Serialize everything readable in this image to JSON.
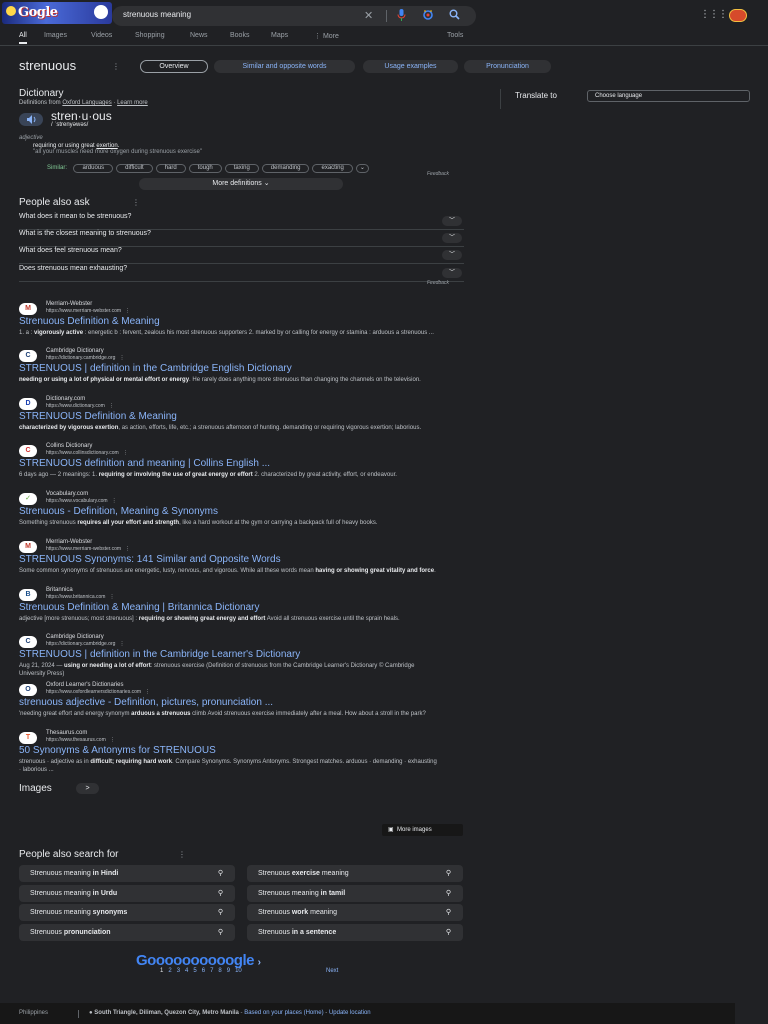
{
  "header": {
    "logo_text": "Gogle",
    "query": "strenuous meaning",
    "clear_icon": "close-icon",
    "mic_icon": "microphone-icon",
    "lens_icon": "lens-icon",
    "search_icon": "search-icon",
    "apps_icon": "apps-grid-icon"
  },
  "tabs": [
    {
      "label": "All"
    },
    {
      "label": "Images"
    },
    {
      "label": "Videos"
    },
    {
      "label": "Shopping"
    },
    {
      "label": "News"
    },
    {
      "label": "Books"
    },
    {
      "label": "Maps"
    },
    {
      "label": "⋮ More"
    }
  ],
  "tools_label": "Tools",
  "term_bar": {
    "term": "strenuous",
    "chips": [
      "Overview",
      "Similar and opposite words",
      "Usage examples",
      "Pronunciation"
    ]
  },
  "dictionary": {
    "title": "Dictionary",
    "source_prefix": "Definitions from",
    "source": "Oxford Languages",
    "learn_more": "Learn more",
    "headword": "stren·u·ous",
    "phonetic": "/ ˈstrenyəwəs/",
    "pos": "adjective",
    "definition_start": "requiring or using great ",
    "definition_link": "exertion",
    "definition_end": ".",
    "example": "\"all your muscles need more oxygen during strenuous exercise\"",
    "similar_label": "Similar:",
    "similar": [
      "arduous",
      "difficult",
      "hard",
      "tough",
      "taxing",
      "demanding",
      "exacting"
    ],
    "feedback": "Feedback",
    "more_definitions": "More definitions",
    "translate_label": "Translate to",
    "choose_language": "Choose language"
  },
  "paa": {
    "title": "People also ask",
    "questions": [
      "What does it mean to be strenuous?",
      "What is the closest meaning to strenuous?",
      "What does feel strenuous mean?",
      "Does strenuous mean exhausting?"
    ],
    "feedback": "Feedback"
  },
  "results": [
    {
      "site": "Merriam-Webster",
      "url": "https://www.merriam-webster.com",
      "title": "Strenuous Definition & Meaning",
      "fav": "M",
      "fav_color": "#c0392b",
      "snippet_pre": "1. a : ",
      "snippet_bold": "vigorously active",
      "snippet_post": " : energetic b : fervent, zealous his most strenuous supporters 2. marked by or calling for energy or stamina : arduous a strenuous ..."
    },
    {
      "site": "Cambridge Dictionary",
      "url": "https://dictionary.cambridge.org",
      "title": "STRENUOUS | definition in the Cambridge English Dictionary",
      "fav": "C",
      "fav_color": "#1d3f75",
      "snippet_pre": "",
      "snippet_bold": "needing or using a lot of physical or mental effort or energy",
      "snippet_post": ". He rarely does anything more strenuous than changing the channels on the television."
    },
    {
      "site": "Dictionary.com",
      "url": "https://www.dictionary.com",
      "title": "STRENUOUS Definition & Meaning",
      "fav": "D",
      "fav_color": "#1a3fb0",
      "snippet_pre": "",
      "snippet_bold": "characterized by vigorous exertion",
      "snippet_post": ", as action, efforts, life, etc.; a strenuous afternoon of hunting. demanding or requiring vigorous exertion; laborious."
    },
    {
      "site": "Collins Dictionary",
      "url": "https://www.collinsdictionary.com",
      "title": "STRENUOUS definition and meaning | Collins English ...",
      "fav": "C",
      "fav_color": "#d32f2f",
      "snippet_pre": "6 days ago — 2 meanings: 1. ",
      "snippet_bold": "requiring or involving the use of great energy or effort",
      "snippet_post": " 2. characterized by great activity, effort, or endeavour."
    },
    {
      "site": "Vocabulary.com",
      "url": "https://www.vocabulary.com",
      "title": "Strenuous - Definition, Meaning & Synonyms",
      "fav": "✓",
      "fav_color": "#5fa83a",
      "snippet_pre": "Something strenuous ",
      "snippet_bold": "requires all your effort and strength",
      "snippet_post": ", like a hard workout at the gym or carrying a backpack full of heavy books."
    },
    {
      "site": "Merriam-Webster",
      "url": "https://www.merriam-webster.com",
      "title": "STRENUOUS Synonyms: 141 Similar and Opposite Words",
      "fav": "M",
      "fav_color": "#c0392b",
      "snippet_pre": "Some common synonyms of strenuous are energetic, lusty, nervous, and vigorous. While all these words mean ",
      "snippet_bold": "having or showing great vitality and force",
      "snippet_post": "."
    },
    {
      "site": "Britannica",
      "url": "https://www.britannica.com",
      "title": "Strenuous Definition & Meaning | Britannica Dictionary",
      "fav": "B",
      "fav_color": "#1a4e8a",
      "snippet_pre": "adjective [more strenuous; most strenuous] : ",
      "snippet_bold": "requiring or showing great energy and effort",
      "snippet_post": " Avoid all strenuous exercise until the sprain heals."
    },
    {
      "site": "Cambridge Dictionary",
      "url": "https://dictionary.cambridge.org",
      "title": "STRENUOUS | definition in the Cambridge Learner's Dictionary",
      "fav": "C",
      "fav_color": "#1d3f75",
      "snippet_pre": "Aug 21, 2024 — ",
      "snippet_bold": "using or needing a lot of effort",
      "snippet_post": ": strenuous exercise (Definition of strenuous from the Cambridge Learner's Dictionary © Cambridge University Press)"
    },
    {
      "site": "Oxford Learner's Dictionaries",
      "url": "https://www.oxfordlearnersdictionaries.com",
      "title": "strenuous adjective - Definition, pictures, pronunciation ...",
      "fav": "O",
      "fav_color": "#1d3f75",
      "snippet_pre": "'needing great effort and energy synonym ",
      "snippet_bold": "arduous a strenuous",
      "snippet_post": " climb Avoid strenuous exercise immediately after a meal. How about a stroll in the park?"
    },
    {
      "site": "Thesaurus.com",
      "url": "https://www.thesaurus.com",
      "title": "50 Synonyms & Antonyms for STRENUOUS",
      "fav": "T",
      "fav_color": "#e8582b",
      "snippet_pre": "strenuous · adjective as in ",
      "snippet_bold": "difficult; requiring hard work",
      "snippet_post": ". Compare Synonyms. Synonyms Antonyms. Strongest matches. arduous · demanding · exhausting · laborious ..."
    }
  ],
  "images": {
    "title": "Images",
    "arrow": ">",
    "more": "More images"
  },
  "pas": {
    "title": "People also search for",
    "items": [
      {
        "pre": "Strenuous meaning ",
        "bold": "in Hindi",
        "post": ""
      },
      {
        "pre": "Strenuous ",
        "bold": "exercise",
        "post": " meaning"
      },
      {
        "pre": "Strenuous meaning ",
        "bold": "in Urdu",
        "post": ""
      },
      {
        "pre": "Strenuous meaning ",
        "bold": "in tamil",
        "post": ""
      },
      {
        "pre": "Strenuous meaning ",
        "bold": "synonyms",
        "post": ""
      },
      {
        "pre": "Strenuous ",
        "bold": "work",
        "post": " meaning"
      },
      {
        "pre": "Strenuous ",
        "bold": "pronunciation",
        "post": ""
      },
      {
        "pre": "Strenuous ",
        "bold": "in a sentence",
        "post": ""
      }
    ]
  },
  "pagination": {
    "logo": "Goooooooooogle",
    "pages": [
      "1",
      "2",
      "3",
      "4",
      "5",
      "6",
      "7",
      "8",
      "9",
      "10"
    ],
    "next": "Next"
  },
  "footer": {
    "country": "Philippines",
    "location": "South Triangle, Diliman, Quezon City, Metro Manila",
    "based_on": "Based on your places (Home)",
    "update": "Update location"
  }
}
